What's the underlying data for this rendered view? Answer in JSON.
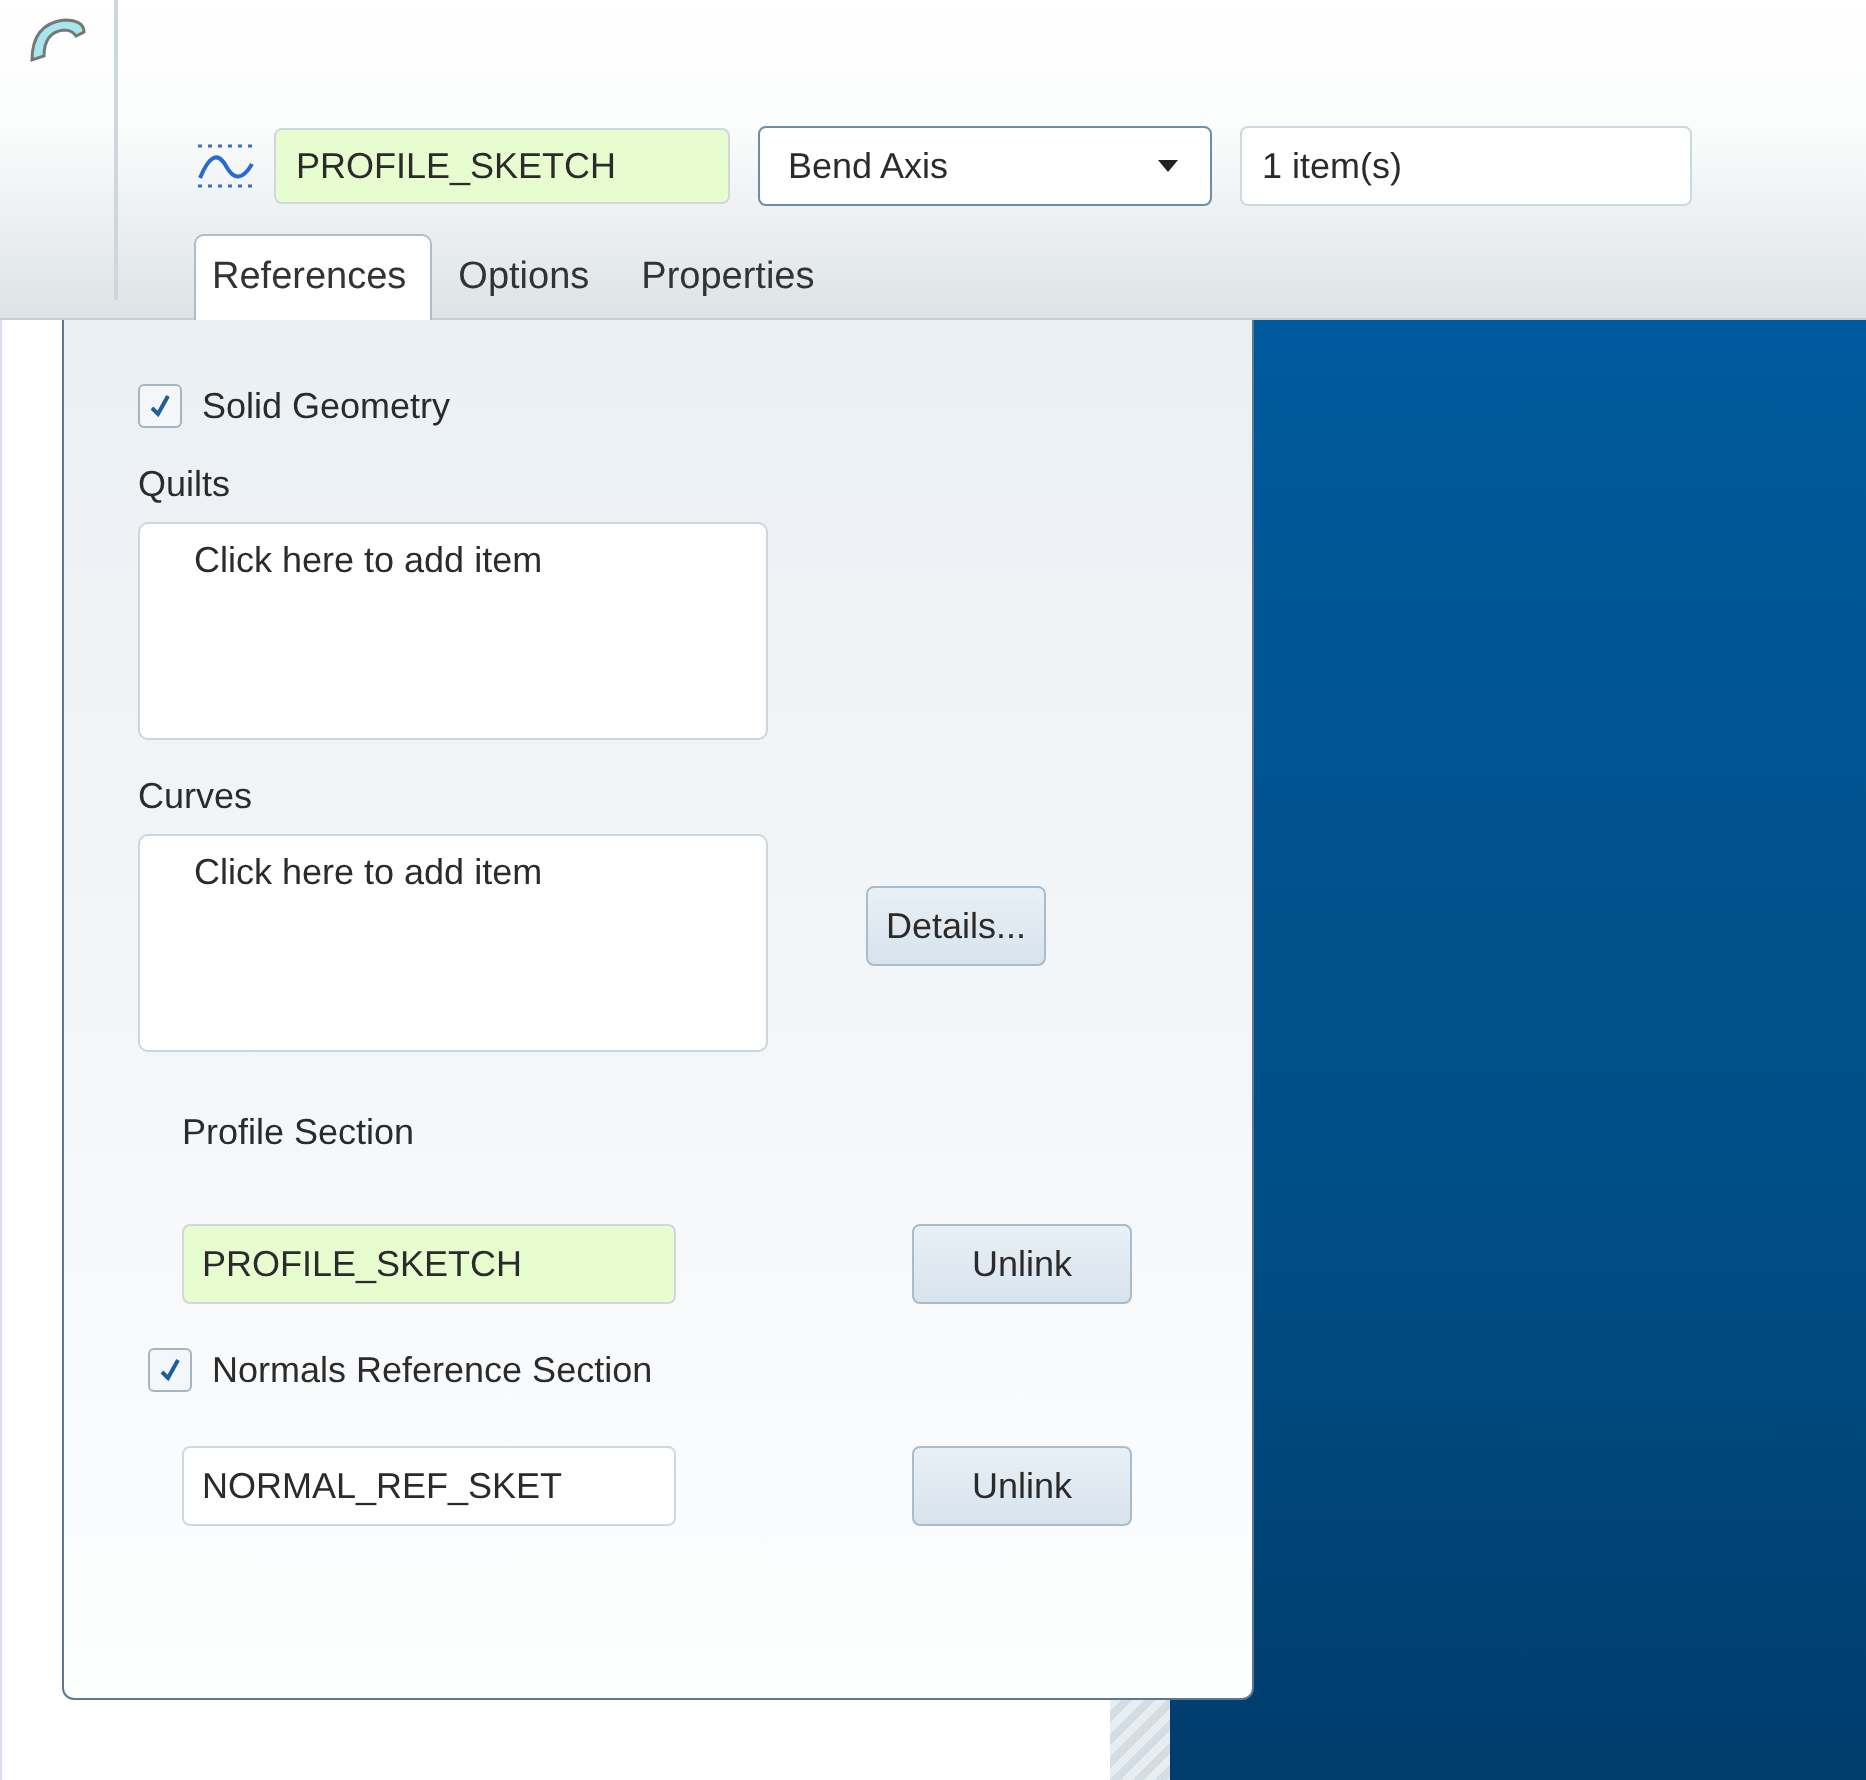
{
  "toolbar": {
    "sketch_field": {
      "value": "PROFILE_SKETCH",
      "highlighted": true
    },
    "bend_axis": {
      "value": "Bend Axis"
    },
    "bend_axis_collector": {
      "value": "1 item(s)"
    }
  },
  "tabs": [
    {
      "label": "References",
      "selected": true
    },
    {
      "label": "Options",
      "selected": false
    },
    {
      "label": "Properties",
      "selected": false
    }
  ],
  "references": {
    "solid_geometry": {
      "label": "Solid Geometry",
      "checked": true
    },
    "quilts": {
      "label": "Quilts",
      "prompt": "Click here to add item"
    },
    "curves": {
      "label": "Curves",
      "prompt": "Click here to add item"
    },
    "details_button": "Details...",
    "profile_section": {
      "label": "Profile Section",
      "value": "PROFILE_SKETCH",
      "highlighted": true,
      "button": "Unlink"
    },
    "normals_reference": {
      "label": "Normals Reference Section",
      "checked": true,
      "value": "NORMAL_REF_SKET",
      "highlighted": false,
      "button": "Unlink"
    }
  }
}
